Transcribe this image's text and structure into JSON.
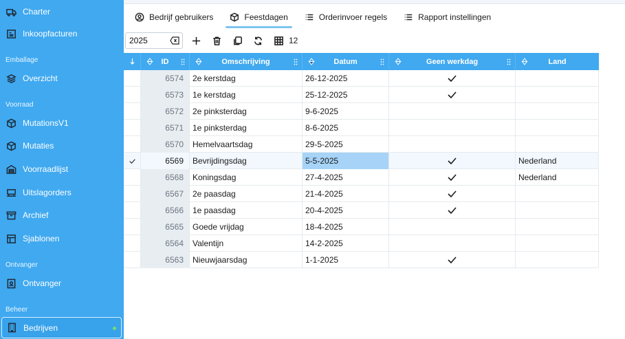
{
  "sidebar": {
    "items_top": [
      {
        "label": "Charter",
        "icon": "truck-icon"
      },
      {
        "label": "Inkoopfacturen",
        "icon": "invoice-icon"
      }
    ],
    "sections": [
      {
        "title": "Emballage",
        "items": [
          {
            "label": "Overzicht",
            "icon": "layers-icon"
          }
        ]
      },
      {
        "title": "Voorraad",
        "items": [
          {
            "label": "MutationsV1",
            "icon": "box-icon"
          },
          {
            "label": "Mutaties",
            "icon": "box-icon"
          },
          {
            "label": "Voorraadlijst",
            "icon": "warehouse-icon"
          },
          {
            "label": "Uitslagorders",
            "icon": "forklift-icon"
          },
          {
            "label": "Archief",
            "icon": "archive-icon"
          },
          {
            "label": "Sjablonen",
            "icon": "template-icon"
          }
        ]
      },
      {
        "title": "Ontvanger",
        "items": [
          {
            "label": "Ontvanger",
            "icon": "contact-icon"
          }
        ]
      },
      {
        "title": "Beheer",
        "items": [
          {
            "label": "Bedrijven",
            "icon": "building-icon"
          }
        ]
      }
    ]
  },
  "tabs": [
    {
      "label": "Bedrijf gebruikers",
      "icon": "user-circle-icon"
    },
    {
      "label": "Feestdagen",
      "icon": "cube-icon",
      "active": true
    },
    {
      "label": "Orderinvoer regels",
      "icon": "list-icon"
    },
    {
      "label": "Rapport instellingen",
      "icon": "list-icon"
    }
  ],
  "toolbar": {
    "year_value": "2025",
    "row_count": "12"
  },
  "grid": {
    "columns": [
      "",
      "ID",
      "Omschrijving",
      "Datum",
      "Geen werkdag",
      "Land"
    ],
    "rows": [
      {
        "id": "6574",
        "omschrijving": "2e kerstdag",
        "datum": "26-12-2025",
        "geen_werkdag": true,
        "land": ""
      },
      {
        "id": "6573",
        "omschrijving": "1e kerstdag",
        "datum": "25-12-2025",
        "geen_werkdag": true,
        "land": ""
      },
      {
        "id": "6572",
        "omschrijving": "2e pinksterdag",
        "datum": "9-6-2025",
        "geen_werkdag": false,
        "land": ""
      },
      {
        "id": "6571",
        "omschrijving": "1e pinksterdag",
        "datum": "8-6-2025",
        "geen_werkdag": false,
        "land": ""
      },
      {
        "id": "6570",
        "omschrijving": "Hemelvaartsdag",
        "datum": "29-5-2025",
        "geen_werkdag": false,
        "land": ""
      },
      {
        "id": "6569",
        "omschrijving": "Bevrijdingsdag",
        "datum": "5-5-2025",
        "geen_werkdag": true,
        "land": "Nederland",
        "selected": true
      },
      {
        "id": "6568",
        "omschrijving": "Koningsdag",
        "datum": "27-4-2025",
        "geen_werkdag": true,
        "land": "Nederland"
      },
      {
        "id": "6567",
        "omschrijving": "2e paasdag",
        "datum": "21-4-2025",
        "geen_werkdag": true,
        "land": ""
      },
      {
        "id": "6566",
        "omschrijving": "1e paasdag",
        "datum": "20-4-2025",
        "geen_werkdag": true,
        "land": ""
      },
      {
        "id": "6565",
        "omschrijving": "Goede vrijdag",
        "datum": "18-4-2025",
        "geen_werkdag": false,
        "land": ""
      },
      {
        "id": "6564",
        "omschrijving": "Valentijn",
        "datum": "14-2-2025",
        "geen_werkdag": false,
        "land": ""
      },
      {
        "id": "6563",
        "omschrijving": "Nieuwjaarsdag",
        "datum": "1-1-2025",
        "geen_werkdag": true,
        "land": ""
      }
    ]
  },
  "colors": {
    "sidebar_bg": "#40a9f0",
    "header_bg": "#40a9f0",
    "selected_cell": "#a6d3f7",
    "status_dot": "#6ee06e"
  }
}
